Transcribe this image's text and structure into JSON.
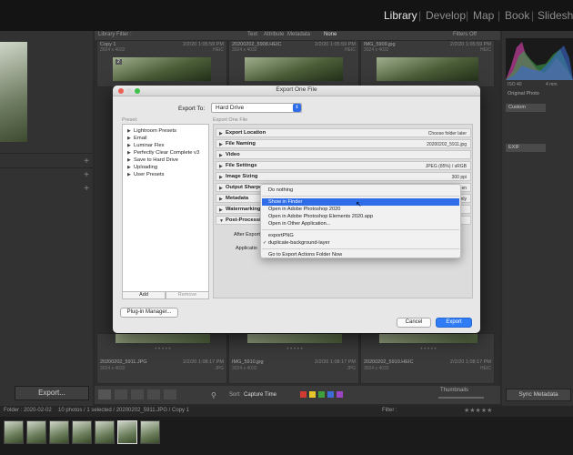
{
  "modules": [
    "Library",
    "Develop",
    "Map",
    "Book",
    "Slideshow"
  ],
  "active_module": "Library",
  "filter_bar": {
    "title": "Library Filter :",
    "options": [
      "Text",
      "Attribute",
      "Metadata",
      "None"
    ],
    "filters_off": "Filters Off"
  },
  "grid": {
    "top_cells": [
      {
        "name": "Copy 1",
        "date": "2/2/20 1:05:59 PM",
        "dims": "3024 x 4032",
        "ext": "HEIC",
        "index": "2"
      },
      {
        "name": "20200202_5908.HEIC",
        "date": "2/2/20 1:05:59 PM",
        "dims": "3024 x 4032",
        "ext": "HEIC",
        "index": ""
      },
      {
        "name": "IMG_5909.jpg",
        "date": "2/2/20 1:05:59 PM",
        "dims": "3024 x 4032",
        "ext": "HEIC",
        "index": ""
      }
    ],
    "bottom_cells": [
      {
        "name": "20200202_5911.JPG",
        "date": "2/2/20 1:08:17 PM",
        "dims": "3024 x 4032",
        "ext": "JPG"
      },
      {
        "name": "IMG_5910.jpg",
        "date": "2/2/20 1:08:17 PM",
        "dims": "3024 x 4032",
        "ext": "JPG"
      },
      {
        "name": "20200202_5910.HEIC",
        "date": "2/2/20 1:08:17 PM",
        "dims": "3024 x 4032",
        "ext": "HEIC"
      }
    ]
  },
  "right_panel": {
    "iso": "ISO 40",
    "focal": "4 mm",
    "original_photo": "Original Photo",
    "preset": "Custom",
    "exif": "EXIF"
  },
  "left_panel": {
    "export_button": "Export..."
  },
  "toolbar": {
    "sort_label": "Sort:",
    "sort_value": "Capture Time",
    "thumbnails_label": "Thumbnails",
    "sync_button": "Sync Metadata",
    "label_colors": [
      "#d33a32",
      "#e7c52c",
      "#3ea03a",
      "#3d6cd7",
      "#9b45c5"
    ]
  },
  "filmbar": {
    "folder": "Folder : 2020-02-02",
    "count": "10 photos / 1 selected / 20200202_5911.JPG / Copy 1",
    "filter_label": "Filter :"
  },
  "dialog": {
    "title": "Export One File",
    "export_to_label": "Export To:",
    "export_to_value": "Hard Drive",
    "preset_label": "Preset:",
    "pane_header": "Export One File",
    "presets": [
      "Lightroom Presets",
      "Email",
      "Luminar Flex",
      "Perfectly Clear Complete v3",
      "Save to Hard Drive",
      "Uploading",
      "User Presets"
    ],
    "add_button": "Add",
    "remove_button": "Remove",
    "plugin_button": "Plug-in Manager...",
    "cancel_button": "Cancel",
    "export_button": "Export",
    "sections": [
      {
        "title": "Export Location",
        "value": "Choose folder later"
      },
      {
        "title": "File Naming",
        "value": "20200202_5911.jpg"
      },
      {
        "title": "Video",
        "value": ""
      },
      {
        "title": "File Settings",
        "value": "JPEG (85%) / sRGB"
      },
      {
        "title": "Image Sizing",
        "value": "300 ppi"
      },
      {
        "title": "Output Sharpe",
        "value": "en"
      },
      {
        "title": "Metadata",
        "value": "nly"
      },
      {
        "title": "Watermarking",
        "value": ""
      },
      {
        "title": "Post-Processi",
        "value": ""
      }
    ],
    "after_export_label": "After Export",
    "application_label": "Applicatio"
  },
  "menu": {
    "items_group1": [
      "Do nothing"
    ],
    "items_group2": [
      "Show in Finder",
      "Open in Adobe Photoshop 2020",
      "Open in Adobe Photoshop Elements 2020.app",
      "Open in Other Application..."
    ],
    "items_group3": [
      "exportPNG",
      "duplicate-background-layer"
    ],
    "items_group4": [
      "Go to Export Actions Folder Now"
    ],
    "highlighted": "Show in Finder",
    "checked": "duplicate-background-layer"
  }
}
